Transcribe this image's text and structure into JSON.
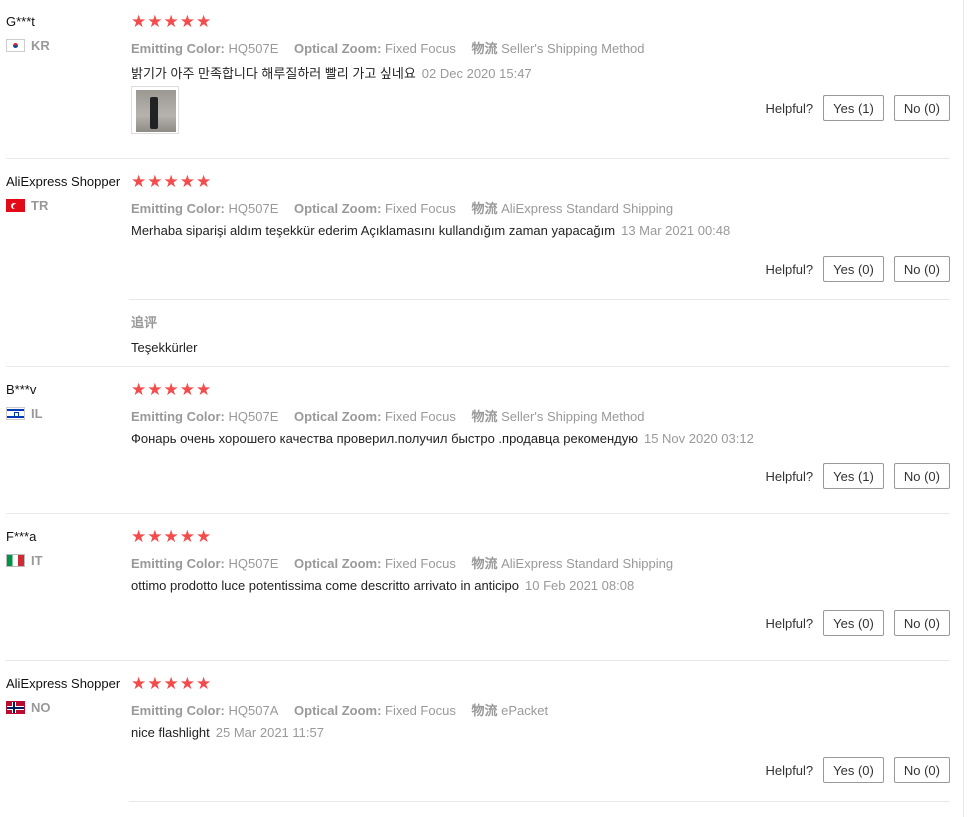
{
  "labels": {
    "emitting_color": "Emitting Color:",
    "optical_zoom": "Optical Zoom:",
    "shipping": "物流",
    "helpful": "Helpful?",
    "followup": "追评"
  },
  "colors": {
    "star": "#f44b4b",
    "meta_gray": "#999999",
    "divider": "#e8e8e8"
  },
  "reviews": [
    {
      "name": "G***t",
      "country": "KR",
      "flag_icon": "korea-flag-icon",
      "stars": "★★★★★",
      "emitting_color": "HQ507E",
      "optical_zoom": "Fixed Focus",
      "shipping": "Seller's Shipping Method",
      "text": "밝기가 아주 만족합니다 해루질하러 빨리 가고 싶네요",
      "date": "02 Dec 2020 15:47",
      "yes": "Yes (1)",
      "no": "No (0)"
    },
    {
      "name": "AliExpress Shopper",
      "country": "TR",
      "flag_icon": "turkey-flag-icon",
      "stars": "★★★★★",
      "emitting_color": "HQ507E",
      "optical_zoom": "Fixed Focus",
      "shipping": "AliExpress Standard Shipping",
      "text": "Merhaba siparişi aldım teşekkür ederim Açıklamasını kullandığım zaman yapacağım",
      "date": "13 Mar 2021 00:48",
      "yes": "Yes (0)",
      "no": "No (0)",
      "followup_text": "Teşekkürler"
    },
    {
      "name": "B***v",
      "country": "IL",
      "flag_icon": "israel-flag-icon",
      "stars": "★★★★★",
      "emitting_color": "HQ507E",
      "optical_zoom": "Fixed Focus",
      "shipping": "Seller's Shipping Method",
      "text": "Фонарь очень хорошего качества проверил.получил быстро .продавца рекомендую",
      "date": "15 Nov 2020 03:12",
      "yes": "Yes (1)",
      "no": "No (0)"
    },
    {
      "name": "F***a",
      "country": "IT",
      "flag_icon": "italy-flag-icon",
      "stars": "★★★★★",
      "emitting_color": "HQ507E",
      "optical_zoom": "Fixed Focus",
      "shipping": "AliExpress Standard Shipping",
      "text": "ottimo prodotto luce potentissima come descritto arrivato in anticipo",
      "date": "10 Feb 2021 08:08",
      "yes": "Yes (0)",
      "no": "No (0)"
    },
    {
      "name": "AliExpress Shopper",
      "country": "NO",
      "flag_icon": "norway-flag-icon",
      "stars": "★★★★★",
      "emitting_color": "HQ507A",
      "optical_zoom": "Fixed Focus",
      "shipping": "ePacket",
      "text": "nice flashlight",
      "date": "25 Mar 2021 11:57",
      "yes": "Yes (0)",
      "no": "No (0)"
    }
  ]
}
